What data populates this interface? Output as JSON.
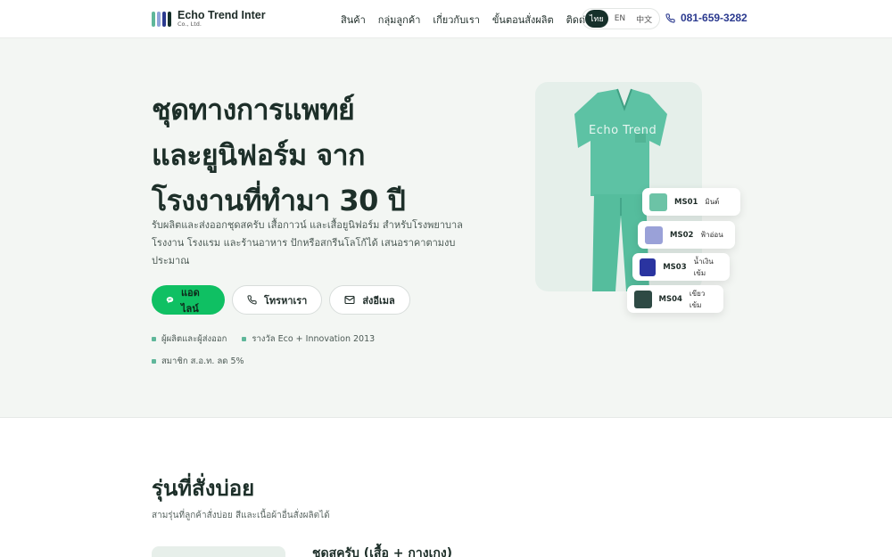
{
  "brand": {
    "name": "Echo Trend Inter",
    "sub": "Co., Ltd.",
    "bar_colors": [
      "#5fb79a",
      "#8fa3d9",
      "#2b3a8f",
      "#16302a"
    ]
  },
  "nav": [
    "สินค้า",
    "กลุ่มลูกค้า",
    "เกี่ยวกับเรา",
    "ขั้นตอนสั่งผลิต",
    "ติดต่อ"
  ],
  "lang": {
    "options": [
      "ไทย",
      "EN",
      "中文"
    ],
    "active": "ไทย"
  },
  "phone": "081-659-3282",
  "hero": {
    "title_lines": [
      "ชุดทางการแพทย์",
      "และยูนิฟอร์ม จาก",
      "โรงงานที่ทำมา 30 ปี"
    ],
    "description": "รับผลิตและส่งออกชุดสครับ เสื้อกาวน์ และเสื้อยูนิฟอร์ม สำหรับโรงพยาบาล โรงงาน โรงแรม และร้านอาหาร ปักหรือสกรีนโลโก้ได้ เสนอราคาตามงบประมาณ",
    "buttons": {
      "line": "แอดไลน์",
      "call": "โทรหาเรา",
      "email": "ส่งอีเมล"
    },
    "badges": [
      "ผู้ผลิตและผู้ส่งออก",
      "รางวัล Eco + Innovation 2013",
      "สมาชิก ส.อ.ท. ลด 5%"
    ],
    "watermark": "Echo Trend"
  },
  "swatches": [
    {
      "code": "MS01",
      "label": "มินต์",
      "color": "#6cc3a6"
    },
    {
      "code": "MS02",
      "label": "ฟ้าอ่อน",
      "color": "#9aa1d8"
    },
    {
      "code": "MS03",
      "label": "น้ำเงินเข้ม",
      "color": "#2a34a0"
    },
    {
      "code": "MS04",
      "label": "เขียวเข้ม",
      "color": "#2e4a44"
    }
  ],
  "popular": {
    "title": "รุ่นที่สั่งบ่อย",
    "subtitle": "สามรุ่นที่ลูกค้าสั่งบ่อย สีและเนื้อผ้าอื่นสั่งผลิตได้",
    "first_card_title": "ชุดสครับ (เสื้อ + กางเกง)"
  }
}
